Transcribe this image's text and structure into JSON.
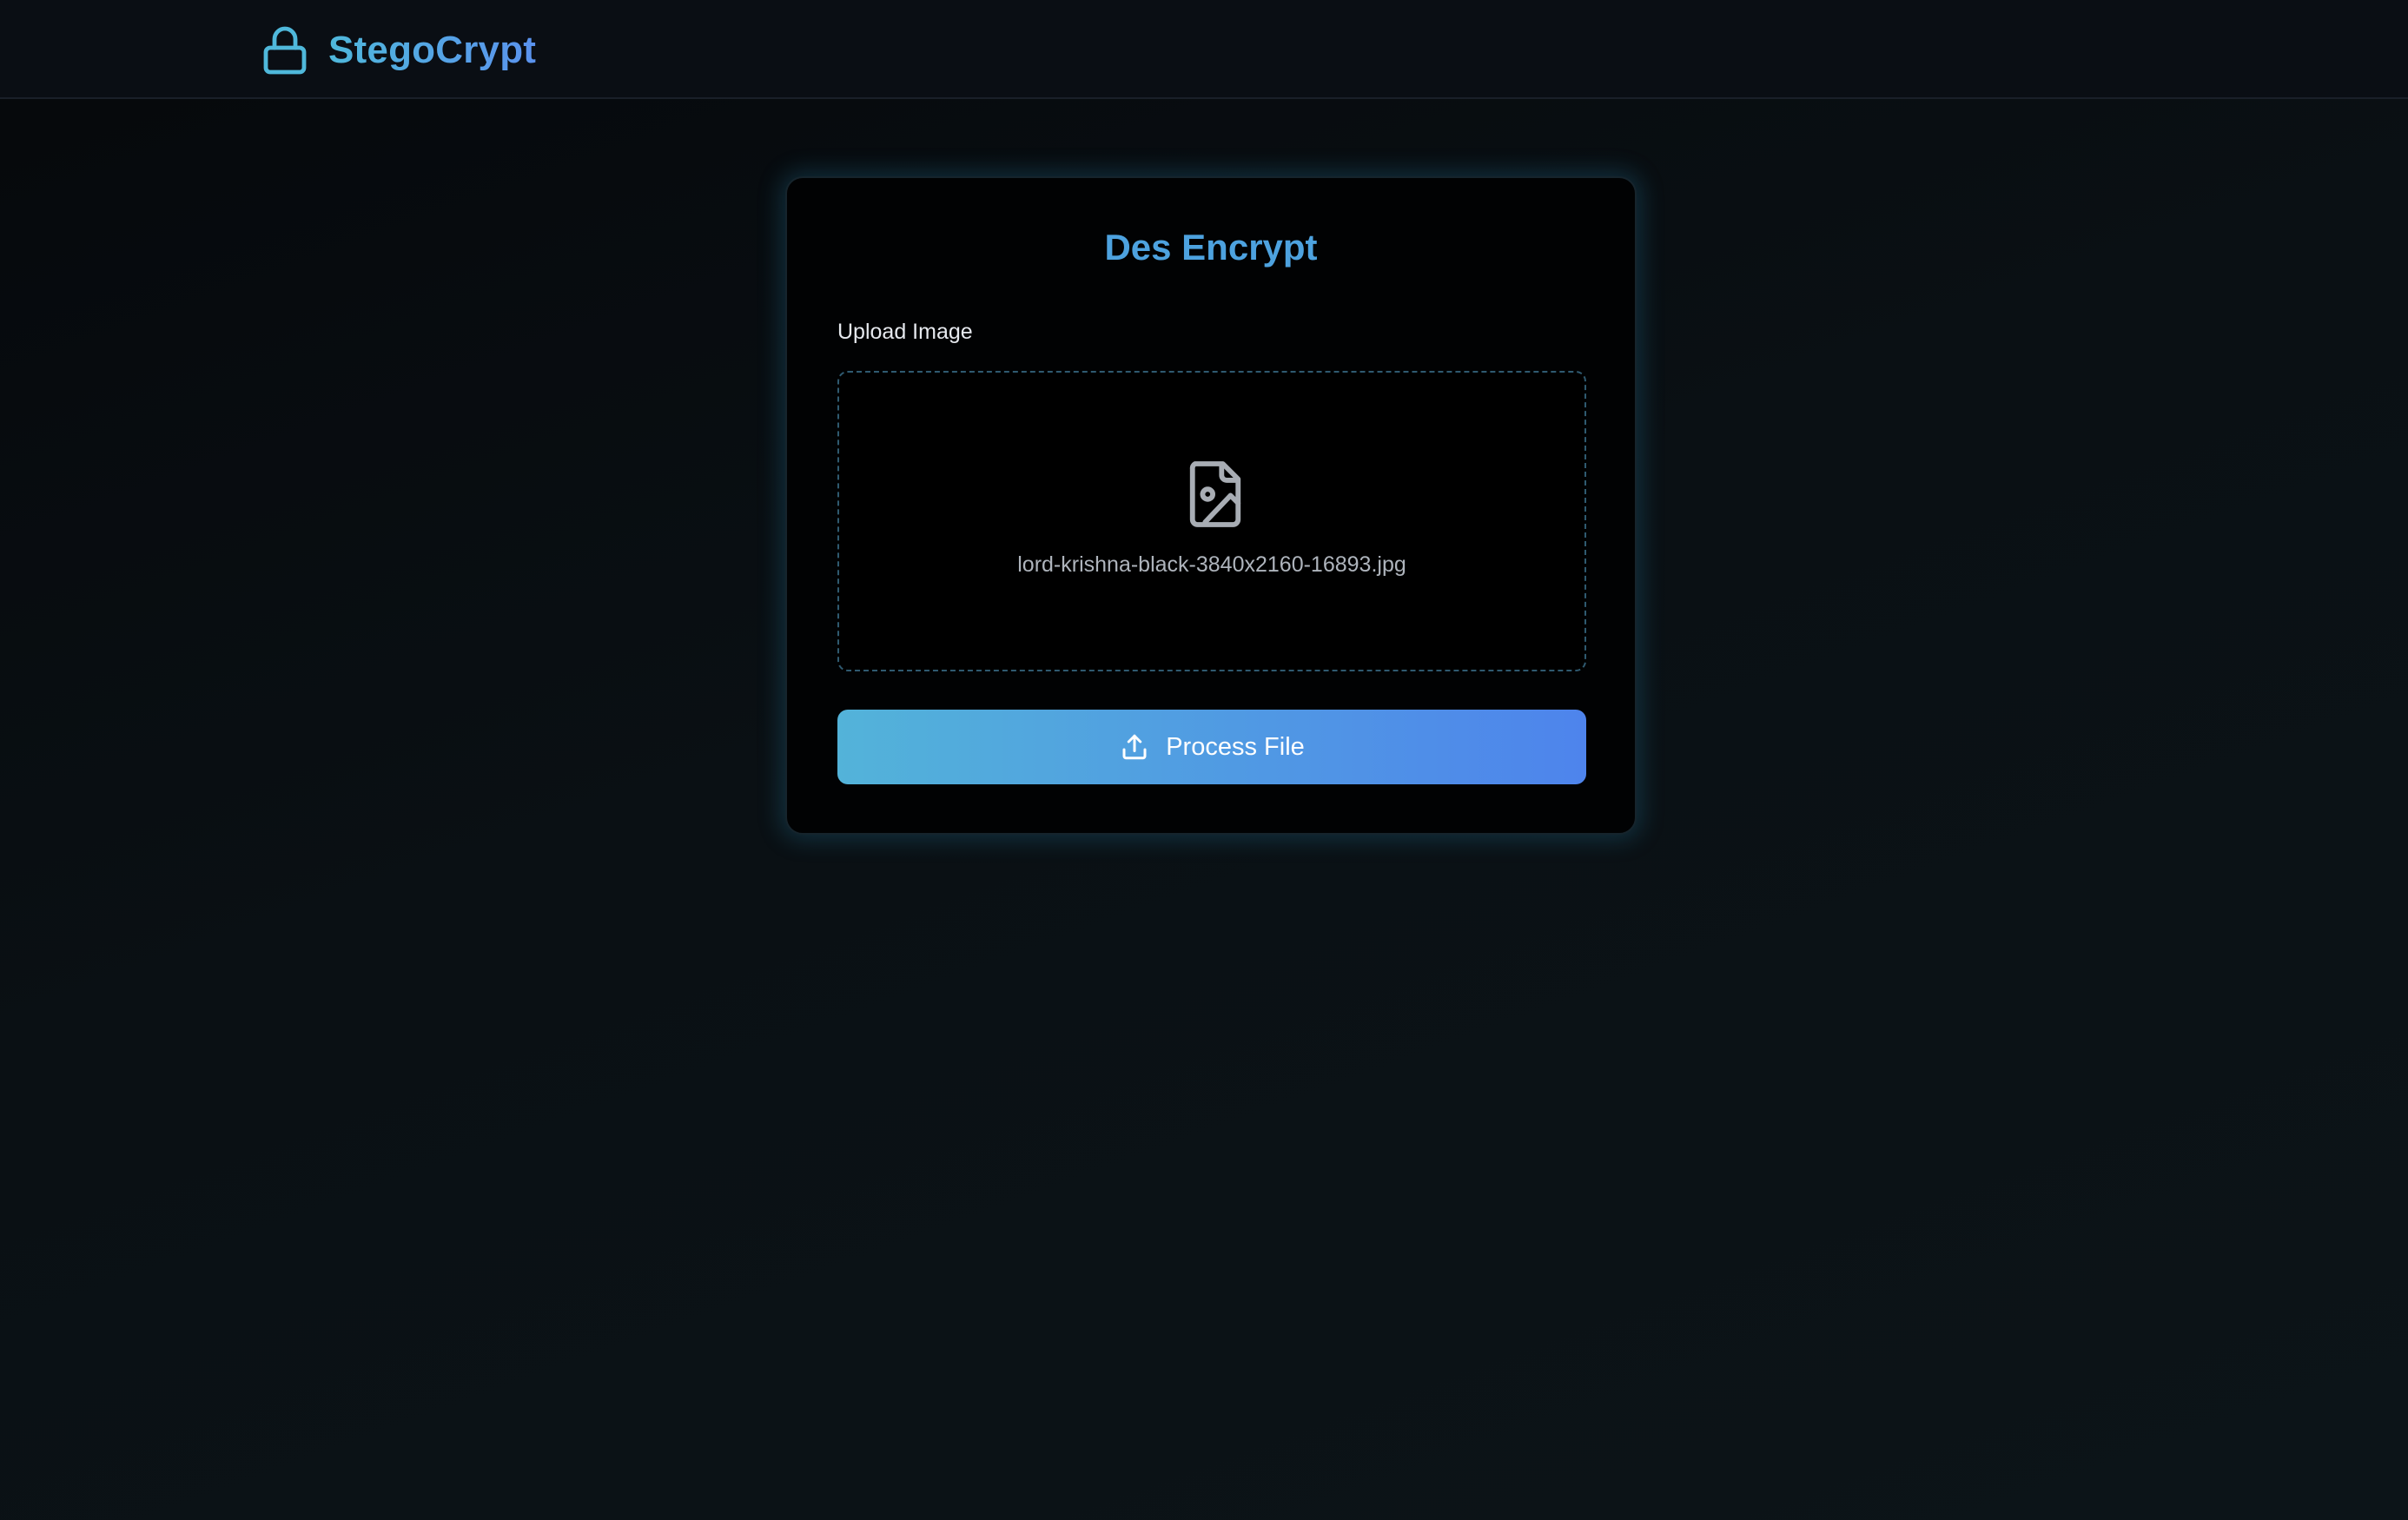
{
  "app": {
    "brand_name": "StegoCrypt",
    "brand_icon": "lock-icon"
  },
  "card": {
    "title": "Des Encrypt",
    "upload_label": "Upload Image",
    "file_icon": "image-file-icon",
    "file_name": "lord-krishna-black-3840x2160-16893.jpg",
    "button_icon": "upload-icon",
    "button_label": "Process File"
  },
  "colors": {
    "accent_start": "#53b3d9",
    "accent_end": "#4e84ec",
    "title": "#4da2df",
    "background": "#0a1014"
  }
}
